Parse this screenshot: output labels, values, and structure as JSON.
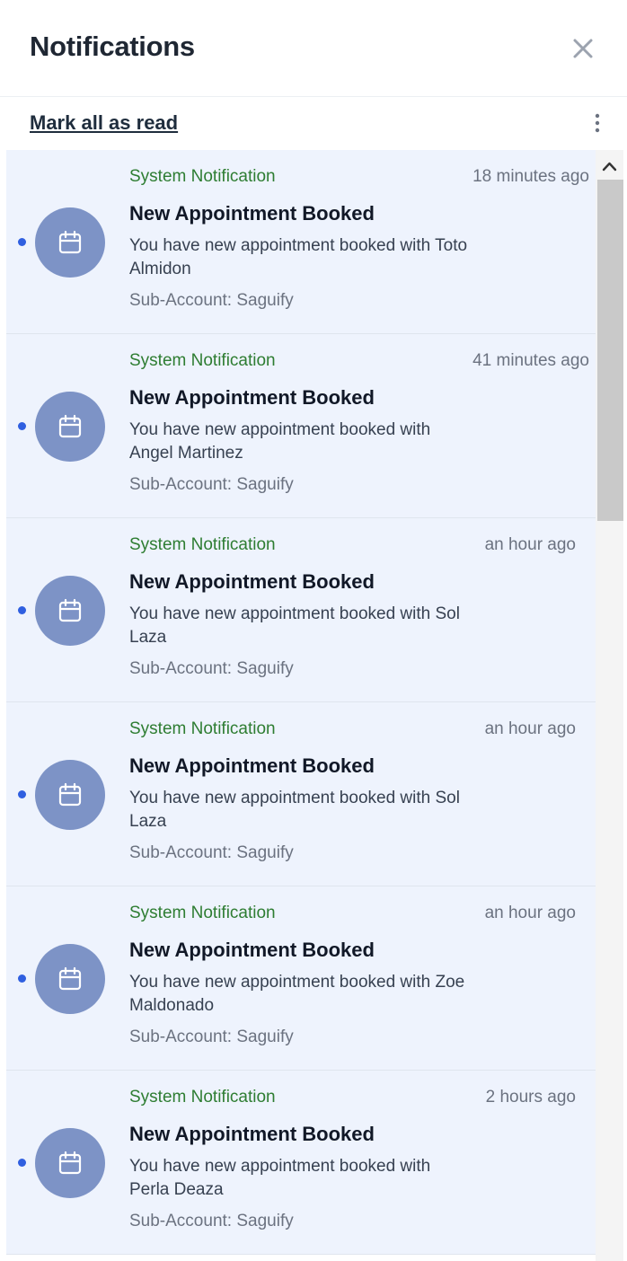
{
  "header": {
    "title": "Notifications"
  },
  "toolbar": {
    "mark_all_label": "Mark all as read"
  },
  "notifications": [
    {
      "source": "System Notification",
      "time": "18 minutes ago",
      "title": "New Appointment Booked",
      "body": "You have new appointment booked with Toto Almidon",
      "sub_account": "Sub-Account: Saguify",
      "unread": true
    },
    {
      "source": "System Notification",
      "time": "41 minutes ago",
      "title": "New Appointment Booked",
      "body": "You have new appointment booked with Angel Martinez",
      "sub_account": "Sub-Account: Saguify",
      "unread": true
    },
    {
      "source": "System Notification",
      "time": "an hour ago",
      "title": "New Appointment Booked",
      "body": "You have new appointment booked with Sol Laza",
      "sub_account": "Sub-Account: Saguify",
      "unread": true
    },
    {
      "source": "System Notification",
      "time": "an hour ago",
      "title": "New Appointment Booked",
      "body": "You have new appointment booked with Sol Laza",
      "sub_account": "Sub-Account: Saguify",
      "unread": true
    },
    {
      "source": "System Notification",
      "time": "an hour ago",
      "title": "New Appointment Booked",
      "body": "You have new appointment booked with Zoe Maldonado",
      "sub_account": "Sub-Account: Saguify",
      "unread": true
    },
    {
      "source": "System Notification",
      "time": "2 hours ago",
      "title": "New Appointment Booked",
      "body": "You have new appointment booked with Perla Deaza",
      "sub_account": "Sub-Account: Saguify",
      "unread": true
    }
  ],
  "icons": {
    "close": "close-icon",
    "more": "more-vertical-icon",
    "avatar": "calendar-icon",
    "scroll_up": "chevron-up-icon"
  },
  "colors": {
    "source_text": "#2e7d32",
    "unread_dot": "#2f5fe0",
    "avatar_bg": "#7d93c6",
    "item_bg": "#eef3fd"
  }
}
